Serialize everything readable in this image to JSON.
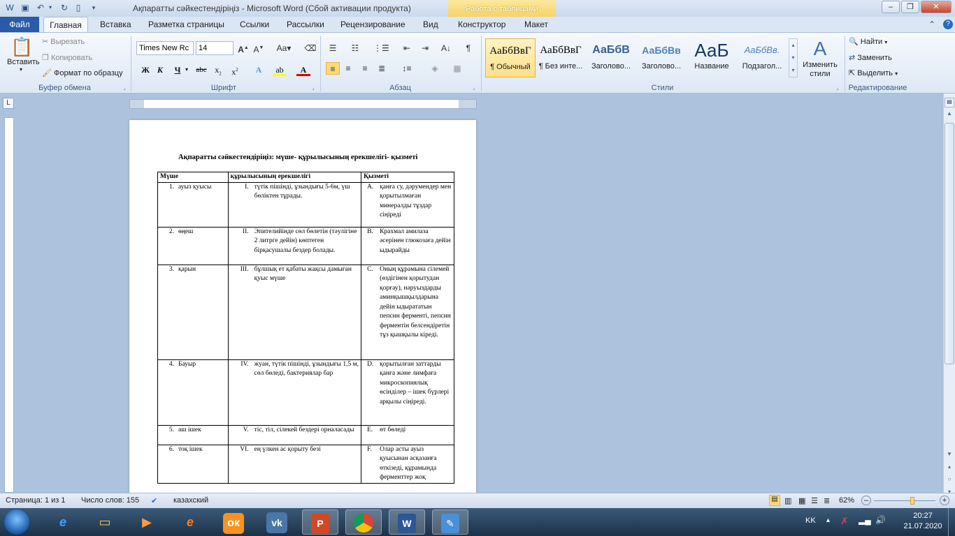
{
  "window": {
    "title": "Ақпаратты сәйкестендіріңіз  -  Microsoft Word (Сбой активации продукта)",
    "table_tools_label": "Работа с таблицами"
  },
  "tabs": {
    "file": "Файл",
    "items": [
      "Главная",
      "Вставка",
      "Разметка страницы",
      "Ссылки",
      "Рассылки",
      "Рецензирование",
      "Вид",
      "Конструктор",
      "Макет"
    ]
  },
  "ribbon": {
    "clipboard": {
      "paste": "Вставить",
      "cut": "Вырезать",
      "copy": "Копировать",
      "format_painter": "Формат по образцу",
      "label": "Буфер обмена"
    },
    "font": {
      "name": "Times New Rc",
      "size": "14",
      "label": "Шрифт"
    },
    "paragraph": {
      "label": "Абзац"
    },
    "styles": {
      "label": "Стили",
      "items": [
        {
          "preview": "АаБбВвГ",
          "name": "¶ Обычный"
        },
        {
          "preview": "АаБбВвГ",
          "name": "¶ Без инте..."
        },
        {
          "preview": "АаБбВ",
          "name": "Заголово..."
        },
        {
          "preview": "АаБбВв",
          "name": "Заголово..."
        },
        {
          "preview": "АаБ",
          "name": "Название"
        },
        {
          "preview": "АаБбВв.",
          "name": "Подзагол..."
        }
      ],
      "change_styles": "Изменить стили"
    },
    "editing": {
      "find": "Найти",
      "replace": "Заменить",
      "select": "Выделить",
      "label": "Редактирование"
    }
  },
  "document": {
    "title": "Ақпаратты сәйкестендіріңіз: мүше- құрылысының ерекшелігі- қызметі",
    "headers": [
      "Мүше",
      "құрылысының ерекшелігі",
      "Қызметі"
    ],
    "rows": [
      {
        "num": "1.",
        "organ": "ауыз қуысы",
        "roman": "I.",
        "structure": "түтік пішінді, ұзындығы 5-6м, үш бөліктен тұрады.",
        "letter": "A.",
        "function": "қанға су, дәрумендер мен қорытылмаған минералды тұздар сіңіреді"
      },
      {
        "num": "2.",
        "organ": "өңеш",
        "roman": "II.",
        "structure": "Эпителийінде сөл бөлетін (тәулігіне 2 литрге дейін) көптеген бірқасушалы бездер болады.",
        "letter": "B.",
        "function": "Крахмал амилаза әсерінен глюкозаға дейін ыдырайды"
      },
      {
        "num": "3.",
        "organ": "қарын",
        "roman": "III.",
        "structure": "бұлшық ет қабаты жақсы дамыған қуыс мүше",
        "letter": "C.",
        "function": "Оның құрамына сілемей (өздігінен қорытудан қорғау), нәруыздарды аминқышқылдарына дейін ыдырататын пепсин ферменті, пепсин ферментін белсендіретін тұз қышқылы кіреді."
      },
      {
        "num": "4.",
        "organ": "Бауыр",
        "roman": "IV.",
        "structure": "жуан, түтік пішінді, ұзындығы 1,5 м, сөл бөледі, бактериялар бар",
        "letter": "D.",
        "function": "қорытылған заттарды қанға және лимфаға микроскопиялық өсінділер – ішек бүрлері арқылы сіңіреді."
      },
      {
        "num": "5.",
        "organ": "аш ішек",
        "roman": "V.",
        "structure": "тіс, тіл, сілекей бездері орналасады",
        "letter": "E.",
        "function": "өт бөледі"
      },
      {
        "num": "6.",
        "organ": "тоқ ішек",
        "roman": "VI.",
        "structure": "ең үлкен ас қорыту безі",
        "letter": "F.",
        "function": "Олар асты ауыз қуысынан асқазанға өткізеді, құрамында ферменттер жоқ"
      }
    ]
  },
  "statusbar": {
    "page": "Страница: 1 из 1",
    "words": "Число слов: 155",
    "language": "казахский",
    "zoom": "62%",
    "zoom_fraction": 0.62
  },
  "taskbar": {
    "lang": "KK",
    "time": "20:27",
    "date": "21.07.2020"
  }
}
